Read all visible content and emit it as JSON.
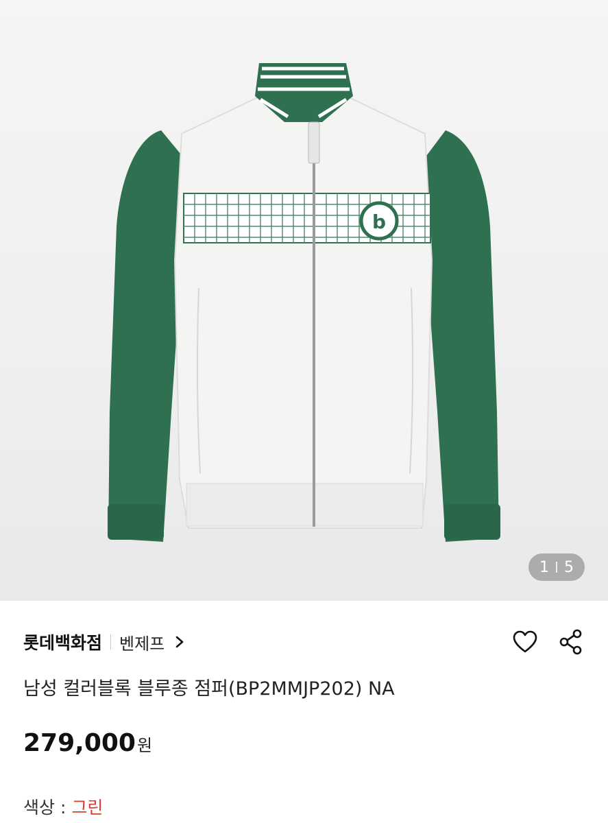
{
  "product_image": {
    "description_icon": "jacket-photo",
    "pager": {
      "current": "1",
      "total": "5"
    }
  },
  "seller": {
    "store": "롯데백화점",
    "brand": "벤제프"
  },
  "actions": {
    "wishlist_icon": "heart-icon",
    "share_icon": "share-icon"
  },
  "product": {
    "title": "남성 컬러블록 블루종 점퍼(BP2MMJP202) NA",
    "price": "279,000",
    "currency": "원",
    "option_label": "색상 : ",
    "option_value": "그린"
  },
  "colors": {
    "jacket_green": "#2e7050",
    "option_value": "#e03a2f"
  }
}
